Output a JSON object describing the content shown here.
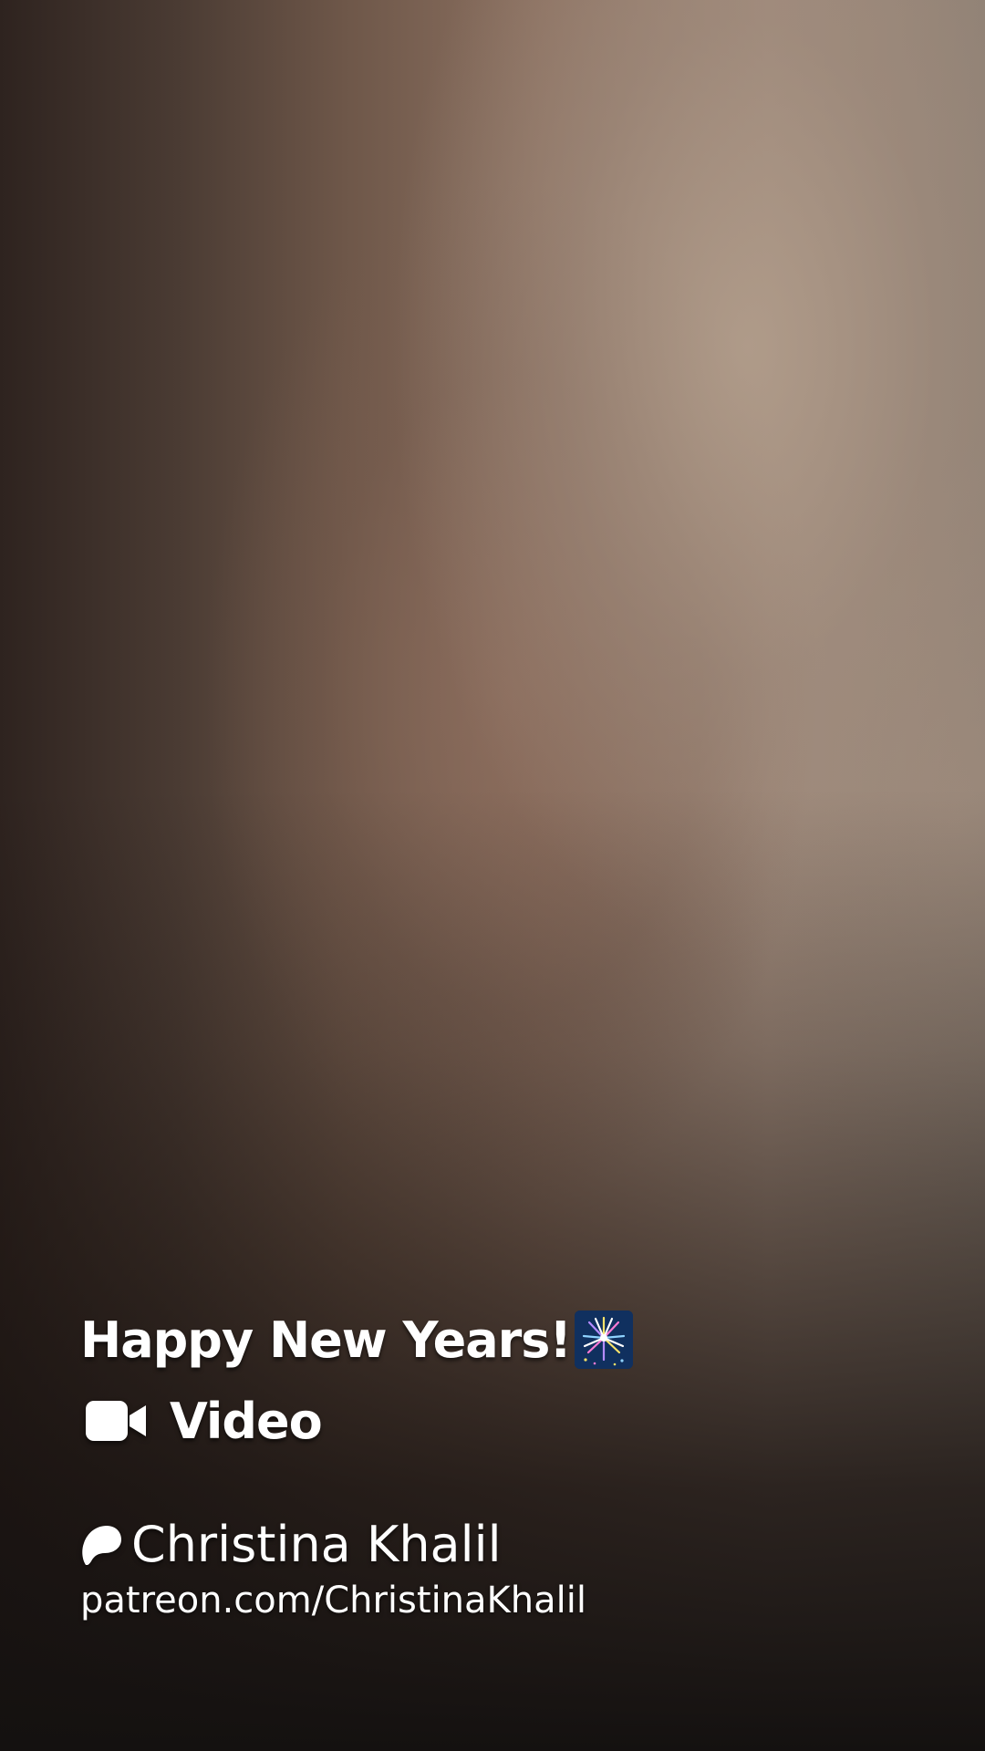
{
  "post": {
    "title": "Happy New Years!",
    "title_emoji": "fireworks-emoji",
    "type_icon": "video-camera-icon",
    "type_label": "Video"
  },
  "creator": {
    "icon": "patreon-logo-icon",
    "name": "Christina Khalil",
    "url": "patreon.com/ChristinaKhalil"
  },
  "colors": {
    "text": "#ffffff",
    "background_top": "#8c7161",
    "background_bottom": "#141110"
  }
}
